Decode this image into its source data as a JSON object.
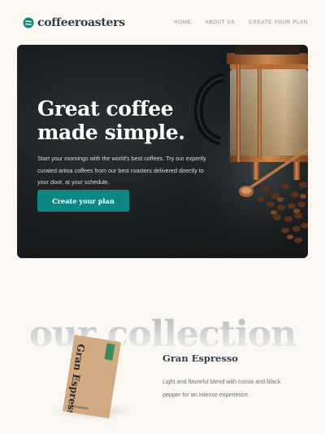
{
  "brand": {
    "name": "coffeeroasters",
    "accent": "#0e8784",
    "dark": "#333d4b",
    "background": "#fbf8f3"
  },
  "nav": {
    "items": [
      {
        "label": "HOME"
      },
      {
        "label": "ABOUT US"
      },
      {
        "label": "CREATE YOUR PLAN"
      }
    ]
  },
  "hero": {
    "title": "Great coffee made simple.",
    "description": "Start your mornings with the world's best coffees. Try our expertly curated artisa coffees from our best roasters delivered directly to your door, at your schedule.",
    "button_label": "Create your plan",
    "image": "french-press-coffee-photo"
  },
  "collection": {
    "heading": "our collection",
    "products": [
      {
        "name": "Gran Espresso",
        "description": "Light and flavorful blend with cocoa and black pepper for an intense experience.",
        "bag_label": "Gran Espresso",
        "bag_brand": "coffeeroasters"
      }
    ]
  }
}
